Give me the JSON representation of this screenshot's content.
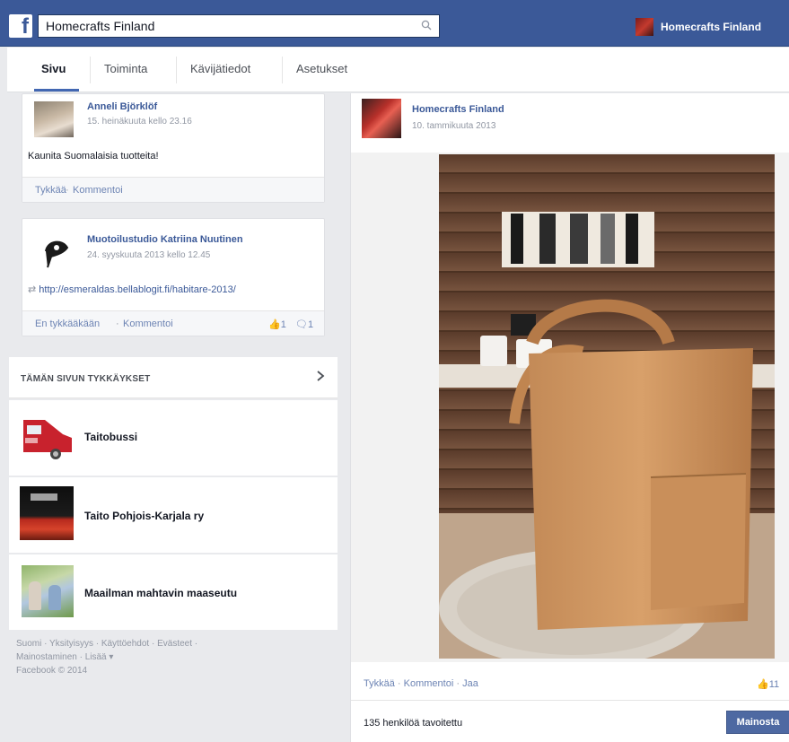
{
  "topbar": {
    "logo_letter": "f",
    "search_value": "Homecrafts Finland",
    "profile_name": "Homecrafts Finland"
  },
  "tabs": [
    {
      "label": "Sivu",
      "active": true
    },
    {
      "label": "Toiminta"
    },
    {
      "label": "Kävijätiedot"
    },
    {
      "label": "Asetukset"
    }
  ],
  "posts": [
    {
      "author": "Anneli Björklöf",
      "date": "15. heinäkuuta kello 23.16",
      "text": "Kaunita Suomalaisia tuotteita!",
      "like_label": "Tykkää",
      "comment_label": "Kommentoi"
    },
    {
      "author": "Muotoilustudio Katriina Nuutinen",
      "date": "24. syyskuuta 2013 kello 12.45",
      "text": "http://esmeraldas.bellablogit.fi/habitare-2013/",
      "like_label": "En tykkääkään",
      "comment_label": "Kommentoi",
      "like_count": "1",
      "comment_count": "1"
    }
  ],
  "page_likes": {
    "title": "TÄMÄN SIVUN TYKKÄYKSET",
    "items": [
      {
        "label": "Taitobussi"
      },
      {
        "label": "Taito Pohjois-Karjala ry"
      },
      {
        "label": "Maailman mahtavin maaseutu"
      }
    ]
  },
  "left_footer": {
    "line1": "Suomi · Yksityisyys · Käyttöehdot · Evästeet ·",
    "line2": "Mainostaminen · Lisää",
    "line3": "Facebook © 2014"
  },
  "main_post": {
    "author": "Homecrafts Finland",
    "date": "10. tammikuuta 2013",
    "like_label": "Tykkää",
    "comment_label": "Kommentoi",
    "share_label": "Jaa",
    "like_count": "11",
    "reach_text": "135 henkilöä tavoitettu",
    "promote_label": "Mainosta"
  },
  "colors": {
    "brand_blue": "#3b5998",
    "link_blue": "#6d84b4",
    "promote_blue": "#4e69a2"
  }
}
